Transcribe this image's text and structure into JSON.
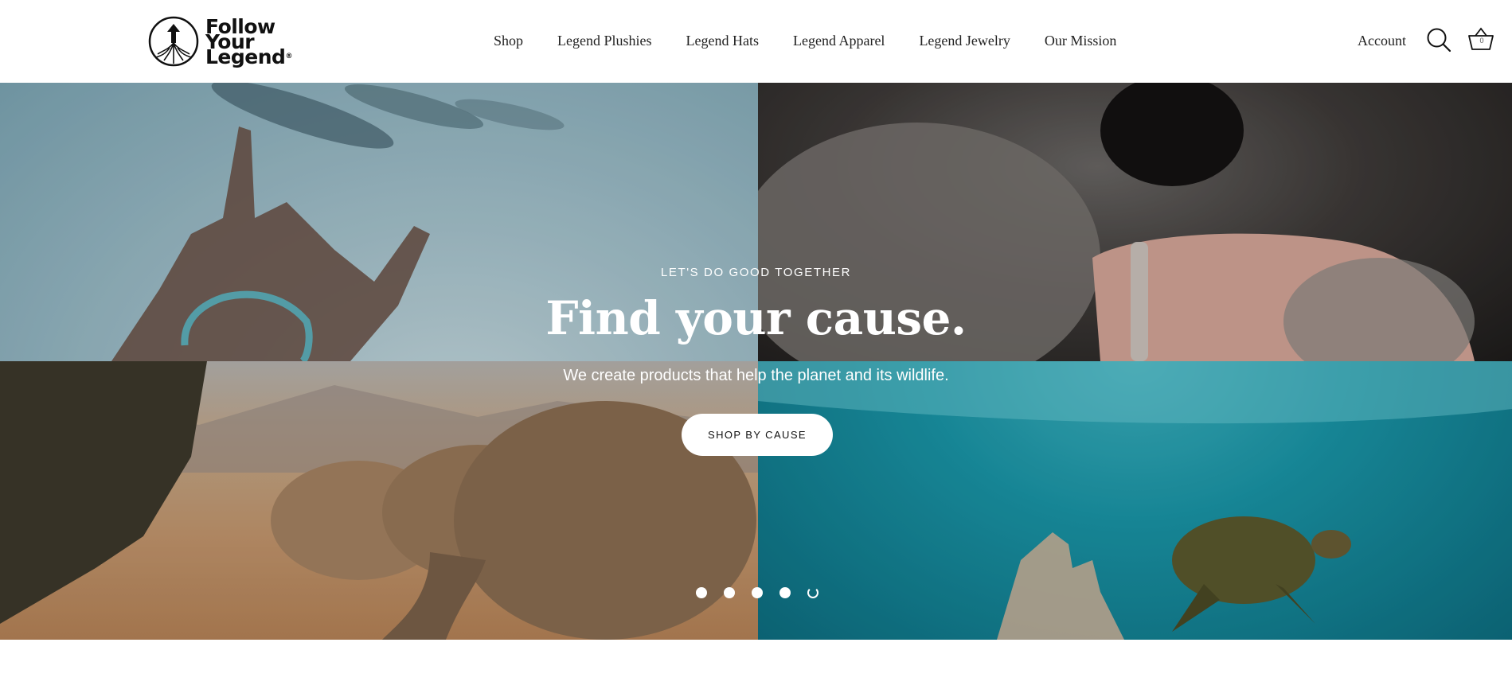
{
  "brand": {
    "logo_line1": "Follow",
    "logo_line2": "Your",
    "logo_line3": "Legend",
    "logo_reg": "®"
  },
  "nav": {
    "items": [
      {
        "label": "Shop"
      },
      {
        "label": "Legend Plushies"
      },
      {
        "label": "Legend Hats"
      },
      {
        "label": "Legend Apparel"
      },
      {
        "label": "Legend Jewelry"
      },
      {
        "label": "Our Mission"
      }
    ]
  },
  "header": {
    "account_label": "Account",
    "cart_count": "0",
    "search_icon": "search-icon",
    "cart_icon": "basket-icon"
  },
  "hero": {
    "eyebrow": "LET'S DO GOOD TOGETHER",
    "headline": "Find your cause.",
    "subline": "We create products that help the planet and its wildlife.",
    "cta_label": "SHOP BY CAUSE",
    "slides_count": 5,
    "active_slide": 5
  },
  "colors": {
    "text": "#111111",
    "header_bg": "#ffffff",
    "hero_text": "#ffffff",
    "cta_bg": "#ffffff"
  }
}
